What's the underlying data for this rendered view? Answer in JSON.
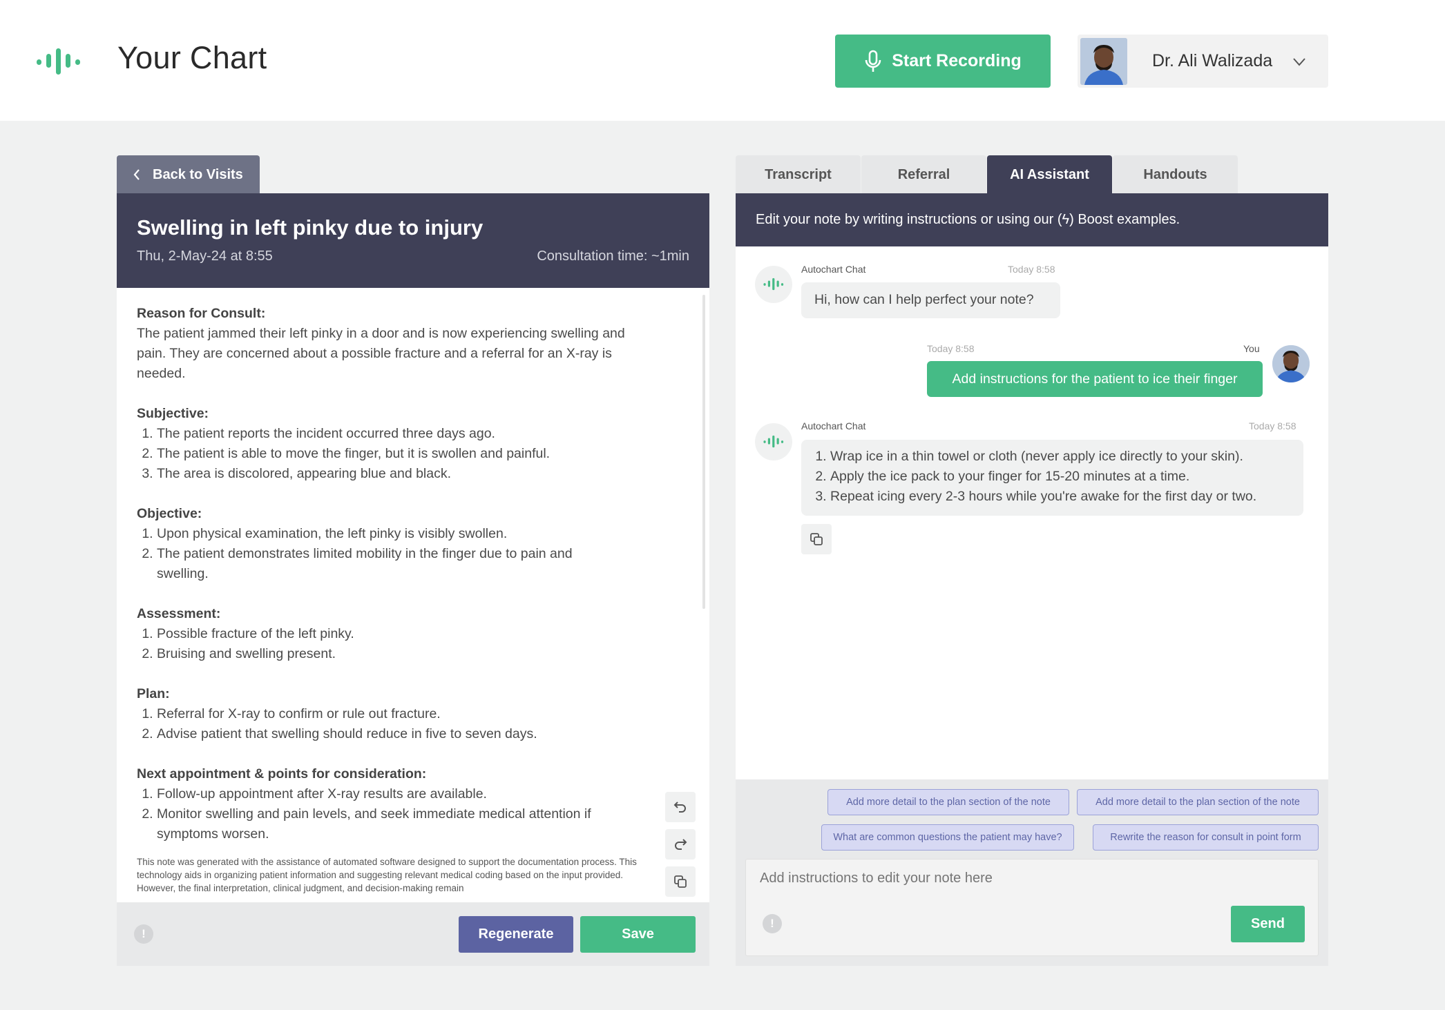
{
  "header": {
    "title": "Your Chart",
    "record_label": "Start Recording",
    "user_name": "Dr. Ali Walizada"
  },
  "colors": {
    "brand_green": "#45bb86",
    "navy": "#3f4057",
    "indigo": "#5c63a2"
  },
  "note": {
    "back_label": "Back to Visits",
    "title": "Swelling in left pinky due to injury",
    "date": "Thu, 2-May-24 at 8:55",
    "consult_time": "Consultation time: ~1min",
    "sections": [
      {
        "heading": "Reason for Consult:",
        "text": "The patient jammed their left pinky in a door and is now experiencing swelling and pain. They are concerned about a possible fracture and a referral for an X-ray is needed."
      },
      {
        "heading": "Subjective:",
        "items": [
          "The patient reports the incident occurred three days ago.",
          "The patient is able to move the finger, but it is swollen and painful.",
          "The area is discolored, appearing blue and black."
        ]
      },
      {
        "heading": "Objective:",
        "items": [
          "Upon physical examination, the left pinky is visibly swollen.",
          "The patient demonstrates limited mobility in the finger due to pain and swelling."
        ]
      },
      {
        "heading": "Assessment:",
        "items": [
          "Possible fracture of the left pinky.",
          "Bruising and swelling present."
        ]
      },
      {
        "heading": "Plan:",
        "items": [
          "Referral for X-ray to confirm or rule out fracture.",
          "Advise patient that swelling should reduce in five to seven days."
        ]
      },
      {
        "heading": "Next appointment & points for consideration:",
        "items": [
          "Follow-up appointment after X-ray results are available.",
          "Monitor swelling and pain levels, and seek immediate medical attention if symptoms worsen."
        ]
      }
    ],
    "disclaimer": "This note was generated with the assistance of automated software designed to support the documentation process. This technology aids in organizing patient information and suggesting relevant medical coding based on the input provided. However, the final interpretation, clinical judgment, and decision-making remain",
    "regenerate_label": "Regenerate",
    "save_label": "Save",
    "info_glyph": "!"
  },
  "tabs": [
    {
      "label": "Transcript",
      "active": false
    },
    {
      "label": "Referral",
      "active": false
    },
    {
      "label": "AI Assistant",
      "active": true
    },
    {
      "label": "Handouts",
      "active": false
    }
  ],
  "assistant": {
    "banner": "Edit your note by writing instructions or using our (ϟ) Boost examples.",
    "messages": [
      {
        "sender": "Autochart Chat",
        "time": "Today 8:58",
        "text": "Hi, how can I help perfect your note?"
      },
      {
        "sender": "You",
        "time": "Today 8:58",
        "text": "Add instructions for the patient to ice their finger"
      },
      {
        "sender": "Autochart Chat",
        "time": "Today 8:58",
        "items": [
          "Wrap ice in a thin towel or cloth (never apply ice directly to your skin).",
          "Apply the ice pack to your finger for 15-20 minutes at a time.",
          "Repeat icing every 2-3 hours while you're awake for the first day or two."
        ]
      }
    ],
    "chips": [
      "Add more detail to the plan section of the note",
      "Add more detail to the plan section of the note",
      "What are common questions the patient may have?",
      "Rewrite the reason for consult in point form"
    ],
    "input_placeholder": "Add instructions to edit your note here",
    "send_label": "Send",
    "info_glyph": "!"
  }
}
